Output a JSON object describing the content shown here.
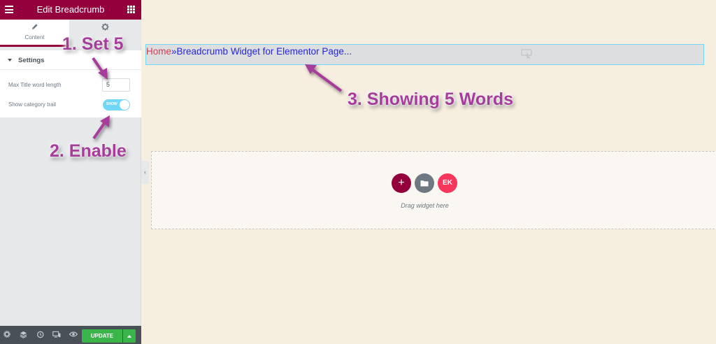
{
  "panel": {
    "header": {
      "title": "Edit Breadcrumb",
      "menu_icon": "hamburger-icon",
      "widgets_icon": "grid-icon"
    },
    "tabs": [
      {
        "label": "Content",
        "icon": "pencil-icon",
        "active": true
      },
      {
        "label": "",
        "icon": "gear-icon",
        "active": false
      }
    ],
    "section": {
      "title": "Settings",
      "controls": {
        "max_title_label": "Max Title word length",
        "max_title_value": "5",
        "trail_label": "Show category trail",
        "trail_state": "SHOW"
      }
    },
    "bottom_bar": {
      "icons": [
        "settings-icon",
        "layers-icon",
        "history-icon",
        "responsive-icon",
        "eye-icon"
      ],
      "update_label": "UPDATE"
    },
    "collapse_glyph": "‹"
  },
  "canvas": {
    "breadcrumb": {
      "home": "Home",
      "separator": "»",
      "current": "Breadcrumb Widget for Elementor Page..."
    },
    "empty_section": {
      "add_glyph": "+",
      "template_icon": "folder-icon",
      "ekit_glyph": "EK",
      "hint": "Drag widget here"
    }
  },
  "annotations": {
    "step1": "1. Set 5",
    "step2": "2. Enable",
    "step3": "3. Showing 5 Words",
    "color": "#a73d9a"
  },
  "colors": {
    "brand": "#93003c",
    "canvas_bg": "#f6eedf",
    "toggle_on": "#71d7f7",
    "update_green": "#39b54a"
  }
}
